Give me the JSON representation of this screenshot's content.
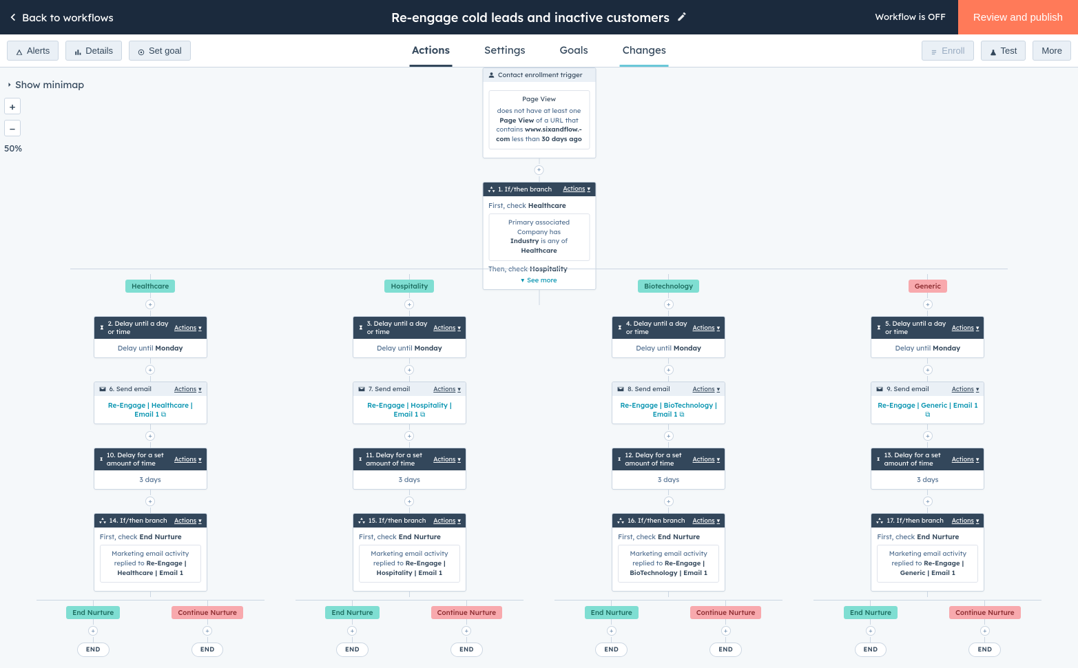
{
  "header": {
    "back_label": "Back to workflows",
    "title": "Re-engage cold leads and inactive customers",
    "status": "Workflow is OFF",
    "review_label": "Review and publish"
  },
  "toolbar": {
    "alerts": "Alerts",
    "details": "Details",
    "set_goal": "Set goal",
    "enroll": "Enroll",
    "test": "Test",
    "more": "More",
    "tabs": {
      "actions": "Actions",
      "settings": "Settings",
      "goals": "Goals",
      "changes": "Changes"
    }
  },
  "canvas": {
    "show_minimap": "Show minimap",
    "zoom": "50%",
    "actions_link": "Actions",
    "trigger": {
      "title": "Contact enrollment trigger",
      "box_title": "Page View",
      "line1": "does not have at least one",
      "page_view_bold": "Page View",
      "line1_tail": "of",
      "line2_pre": "a URL that contains",
      "url_bold": "www.sixandflow.-com",
      "line3_pre": "less than",
      "days_bold": "30 days ago"
    },
    "branch_root": {
      "title": "1. If/then branch",
      "first_check_pre": "First, check",
      "first_check_bold": "Healthcare",
      "rule_pre": "Primary associated Company has",
      "rule_mid_bold": "Industry",
      "rule_mid": "is any of",
      "rule_tail_bold": "Healthcare",
      "then_check_pre": "Then, check",
      "then_check_bold": "Hospitality",
      "see_more": "See more"
    },
    "branches": [
      {
        "chip": "Healthcare",
        "chip_style": "teal",
        "delay_title": "2. Delay until a day or time",
        "delay_text_pre": "Delay until",
        "delay_text_bold": "Monday",
        "send_title": "6. Send email",
        "send_link": "Re-Engage | Healthcare | Email 1",
        "delay2_title": "10. Delay for a set amount of time",
        "delay2_text": "3 days",
        "branch2_title": "14. If/then branch",
        "branch2_check_pre": "First, check",
        "branch2_check_bold": "End Nurture",
        "branch2_rule_title": "Marketing email activity",
        "branch2_rule_pre": "replied to",
        "branch2_rule_bold": "Re-Engage | Healthcare | Email 1",
        "end_left": "End Nurture",
        "end_right": "Continue Nurture",
        "end_pill": "END"
      },
      {
        "chip": "Hospitality",
        "chip_style": "teal",
        "delay_title": "3. Delay until a day or time",
        "delay_text_pre": "Delay until",
        "delay_text_bold": "Monday",
        "send_title": "7. Send email",
        "send_link": "Re-Engage | Hospitality | Email 1",
        "delay2_title": "11. Delay for a set amount of time",
        "delay2_text": "3 days",
        "branch2_title": "15. If/then branch",
        "branch2_check_pre": "First, check",
        "branch2_check_bold": "End Nurture",
        "branch2_rule_title": "Marketing email activity",
        "branch2_rule_pre": "replied to",
        "branch2_rule_bold": "Re-Engage | Hospitality | Email 1",
        "end_left": "End Nurture",
        "end_right": "Continue Nurture",
        "end_pill": "END"
      },
      {
        "chip": "Biotechnology",
        "chip_style": "teal",
        "delay_title": "4. Delay until a day or time",
        "delay_text_pre": "Delay until",
        "delay_text_bold": "Monday",
        "send_title": "8. Send email",
        "send_link": "Re-Engage | BioTechnology | Email 1",
        "delay2_title": "12. Delay for a set amount of time",
        "delay2_text": "3 days",
        "branch2_title": "16. If/then branch",
        "branch2_check_pre": "First, check",
        "branch2_check_bold": "End Nurture",
        "branch2_rule_title": "Marketing email activity",
        "branch2_rule_pre": "replied to",
        "branch2_rule_bold": "Re-Engage | BioTechnology | Email 1",
        "end_left": "End Nurture",
        "end_right": "Continue Nurture",
        "end_pill": "END"
      },
      {
        "chip": "Generic",
        "chip_style": "red",
        "delay_title": "5. Delay until a day or time",
        "delay_text_pre": "Delay until",
        "delay_text_bold": "Monday",
        "send_title": "9. Send email",
        "send_link": "Re-Engage | Generic | Email 1",
        "delay2_title": "13. Delay for a set amount of time",
        "delay2_text": "3 days",
        "branch2_title": "17. If/then branch",
        "branch2_check_pre": "First, check",
        "branch2_check_bold": "End Nurture",
        "branch2_rule_title": "Marketing email activity",
        "branch2_rule_pre": "replied to",
        "branch2_rule_bold": "Re-Engage | Generic | Email 1",
        "end_left": "End Nurture",
        "end_right": "Continue Nurture",
        "end_pill": "END"
      }
    ]
  }
}
